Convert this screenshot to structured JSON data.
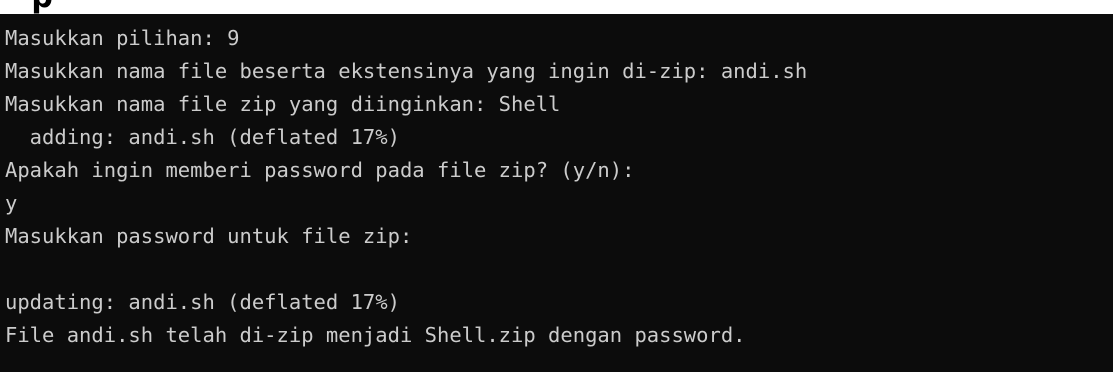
{
  "terminal": {
    "background": "#0c0c0c",
    "foreground": "#cccccc",
    "lines": [
      "Masukkan pilihan: 9",
      "Masukkan nama file beserta ekstensinya yang ingin di-zip: andi.sh",
      "Masukkan nama file zip yang diinginkan: Shell",
      "  adding: andi.sh (deflated 17%)",
      "Apakah ingin memberi password pada file zip? (y/n):",
      "y",
      "Masukkan password untuk file zip:",
      "",
      "updating: andi.sh (deflated 17%)",
      "File andi.sh telah di-zip menjadi Shell.zip dengan password."
    ]
  }
}
